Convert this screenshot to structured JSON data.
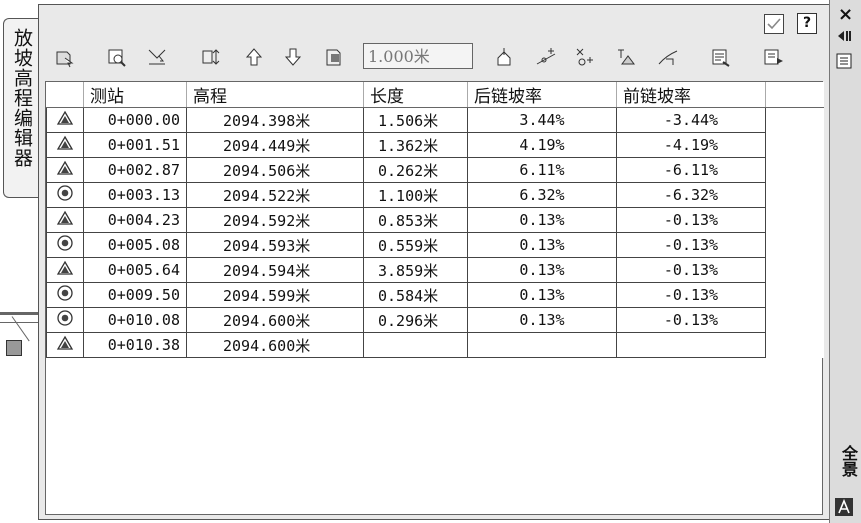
{
  "palette_title": "放坡高程编辑器",
  "toolbar": {
    "value_field": "1.000米"
  },
  "table": {
    "headers": [
      "",
      "测站",
      "高程",
      "长度",
      "后链坡率",
      "前链坡率"
    ],
    "rows": [
      {
        "icon": "triangle-marker-icon",
        "station": "0+000.00",
        "elevation": "2094.398米",
        "length": "1.506米",
        "back_grade": "3.44%",
        "ahead_grade": "-3.44%"
      },
      {
        "icon": "triangle-marker-icon",
        "station": "0+001.51",
        "elevation": "2094.449米",
        "length": "1.362米",
        "back_grade": "4.19%",
        "ahead_grade": "-4.19%"
      },
      {
        "icon": "triangle-marker-icon",
        "station": "0+002.87",
        "elevation": "2094.506米",
        "length": "0.262米",
        "back_grade": "6.11%",
        "ahead_grade": "-6.11%"
      },
      {
        "icon": "circle-marker-icon",
        "station": "0+003.13",
        "elevation": "2094.522米",
        "length": "1.100米",
        "back_grade": "6.32%",
        "ahead_grade": "-6.32%"
      },
      {
        "icon": "triangle-marker-icon",
        "station": "0+004.23",
        "elevation": "2094.592米",
        "length": "0.853米",
        "back_grade": "0.13%",
        "ahead_grade": "-0.13%"
      },
      {
        "icon": "circle-marker-icon",
        "station": "0+005.08",
        "elevation": "2094.593米",
        "length": "0.559米",
        "back_grade": "0.13%",
        "ahead_grade": "-0.13%"
      },
      {
        "icon": "triangle-marker-icon",
        "station": "0+005.64",
        "elevation": "2094.594米",
        "length": "3.859米",
        "back_grade": "0.13%",
        "ahead_grade": "-0.13%"
      },
      {
        "icon": "circle-marker-icon",
        "station": "0+009.50",
        "elevation": "2094.599米",
        "length": "0.584米",
        "back_grade": "0.13%",
        "ahead_grade": "-0.13%"
      },
      {
        "icon": "circle-marker-icon",
        "station": "0+010.08",
        "elevation": "2094.600米",
        "length": "0.296米",
        "back_grade": "0.13%",
        "ahead_grade": "-0.13%"
      },
      {
        "icon": "triangle-marker-icon",
        "station": "0+010.38",
        "elevation": "2094.600米",
        "length": "",
        "back_grade": "",
        "ahead_grade": ""
      }
    ]
  },
  "right_strip": {
    "close_glyph": "×",
    "label": "全景"
  },
  "help_glyph": "?"
}
